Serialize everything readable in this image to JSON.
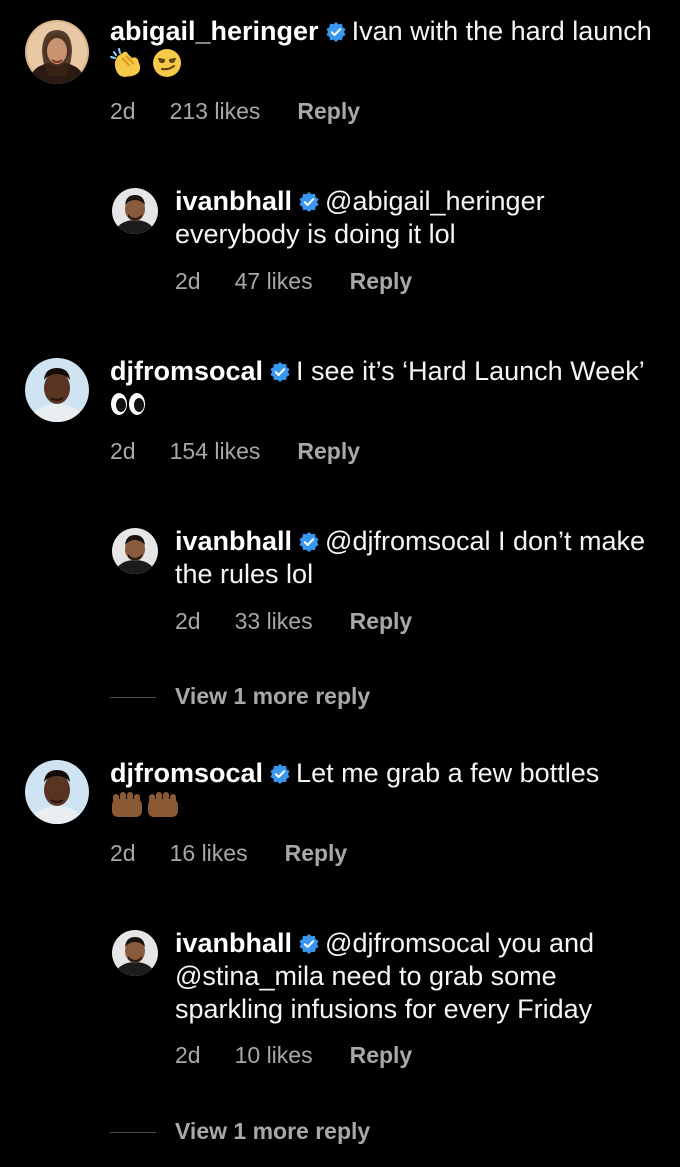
{
  "comments": [
    {
      "username": "abigail_heringer",
      "text_before_emoji": "Ivan with the hard launch",
      "emojis": [
        "clapping-hands-emoji",
        "smirking-face-emoji"
      ],
      "time": "2d",
      "likes": "213 likes",
      "reply": "Reply"
    },
    {
      "username": "ivanbhall",
      "text": "@abigail_heringer everybody is doing it lol",
      "time": "2d",
      "likes": "47 likes",
      "reply": "Reply"
    },
    {
      "username": "djfromsocal",
      "text_before_emoji": "I see it’s ‘Hard Launch Week’",
      "emojis": [
        "eyes-emoji"
      ],
      "time": "2d",
      "likes": "154 likes",
      "reply": "Reply"
    },
    {
      "username": "ivanbhall",
      "text": "@djfromsocal I don’t make the rules lol",
      "time": "2d",
      "likes": "33 likes",
      "reply": "Reply"
    },
    {
      "username": "djfromsocal",
      "text_before_emoji": "Let me grab a few bottles",
      "emojis": [
        "raised-fists-emoji"
      ],
      "time": "2d",
      "likes": "16 likes",
      "reply": "Reply"
    },
    {
      "username": "ivanbhall",
      "text": "@djfromsocal you and @stina_mila need to grab some sparkling infusions for every Friday",
      "time": "2d",
      "likes": "10 likes",
      "reply": "Reply"
    }
  ],
  "view_more_replies": [
    "View 1 more reply",
    "View 1 more reply"
  ],
  "colors": {
    "background": "#000000",
    "text": "#f5f5f5",
    "meta": "#a8a8a8",
    "verified": "#3897f0"
  }
}
